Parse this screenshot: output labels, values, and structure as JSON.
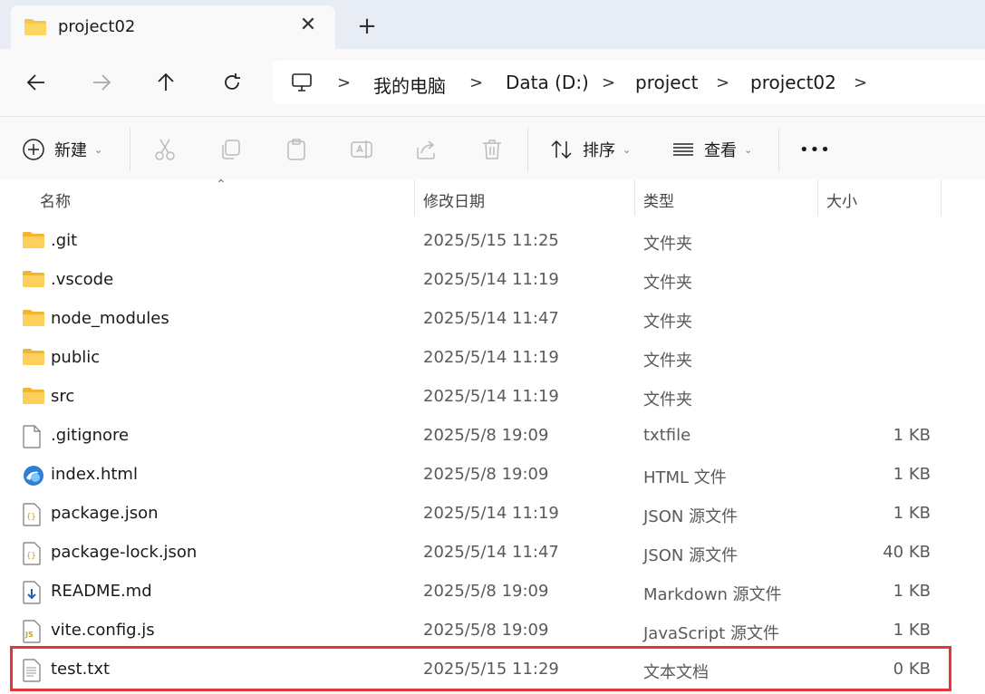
{
  "tab": {
    "title": "project02",
    "close_icon": "close-icon",
    "new_tab": "+"
  },
  "nav": {
    "back_icon": "arrow-left-icon",
    "forward_icon": "arrow-right-icon",
    "up_icon": "arrow-up-icon",
    "refresh_icon": "refresh-icon"
  },
  "breadcrumb": {
    "items": [
      "我的电脑",
      "Data (D:)",
      "project",
      "project02"
    ],
    "separator": ">"
  },
  "toolbar": {
    "new_label": "新建",
    "sort_label": "排序",
    "view_label": "查看",
    "more_label": "•••"
  },
  "columns": {
    "name": "名称",
    "modified": "修改日期",
    "type": "类型",
    "size": "大小"
  },
  "files": [
    {
      "name": ".git",
      "modified": "2025/5/15 11:25",
      "type": "文件夹",
      "size": "",
      "icon": "folder-icon"
    },
    {
      "name": ".vscode",
      "modified": "2025/5/14 11:19",
      "type": "文件夹",
      "size": "",
      "icon": "folder-icon"
    },
    {
      "name": "node_modules",
      "modified": "2025/5/14 11:47",
      "type": "文件夹",
      "size": "",
      "icon": "folder-icon"
    },
    {
      "name": "public",
      "modified": "2025/5/14 11:19",
      "type": "文件夹",
      "size": "",
      "icon": "folder-icon"
    },
    {
      "name": "src",
      "modified": "2025/5/14 11:19",
      "type": "文件夹",
      "size": "",
      "icon": "folder-icon"
    },
    {
      "name": ".gitignore",
      "modified": "2025/5/8 19:09",
      "type": "txtfile",
      "size": "1 KB",
      "icon": "blank-file-icon"
    },
    {
      "name": "index.html",
      "modified": "2025/5/8 19:09",
      "type": "HTML 文件",
      "size": "1 KB",
      "icon": "browser-file-icon"
    },
    {
      "name": "package.json",
      "modified": "2025/5/14 11:19",
      "type": "JSON 源文件",
      "size": "1 KB",
      "icon": "json-file-icon"
    },
    {
      "name": "package-lock.json",
      "modified": "2025/5/14 11:47",
      "type": "JSON 源文件",
      "size": "40 KB",
      "icon": "json-file-icon"
    },
    {
      "name": "README.md",
      "modified": "2025/5/8 19:09",
      "type": "Markdown 源文件",
      "size": "1 KB",
      "icon": "markdown-file-icon"
    },
    {
      "name": "vite.config.js",
      "modified": "2025/5/8 19:09",
      "type": "JavaScript 源文件",
      "size": "1 KB",
      "icon": "js-file-icon"
    },
    {
      "name": "test.txt",
      "modified": "2025/5/15 11:29",
      "type": "文本文档",
      "size": "0 KB",
      "icon": "text-file-icon"
    }
  ],
  "colors": {
    "highlight": "#e8353a",
    "folder": "#f6c543",
    "tabbar": "#e8ecf4"
  }
}
